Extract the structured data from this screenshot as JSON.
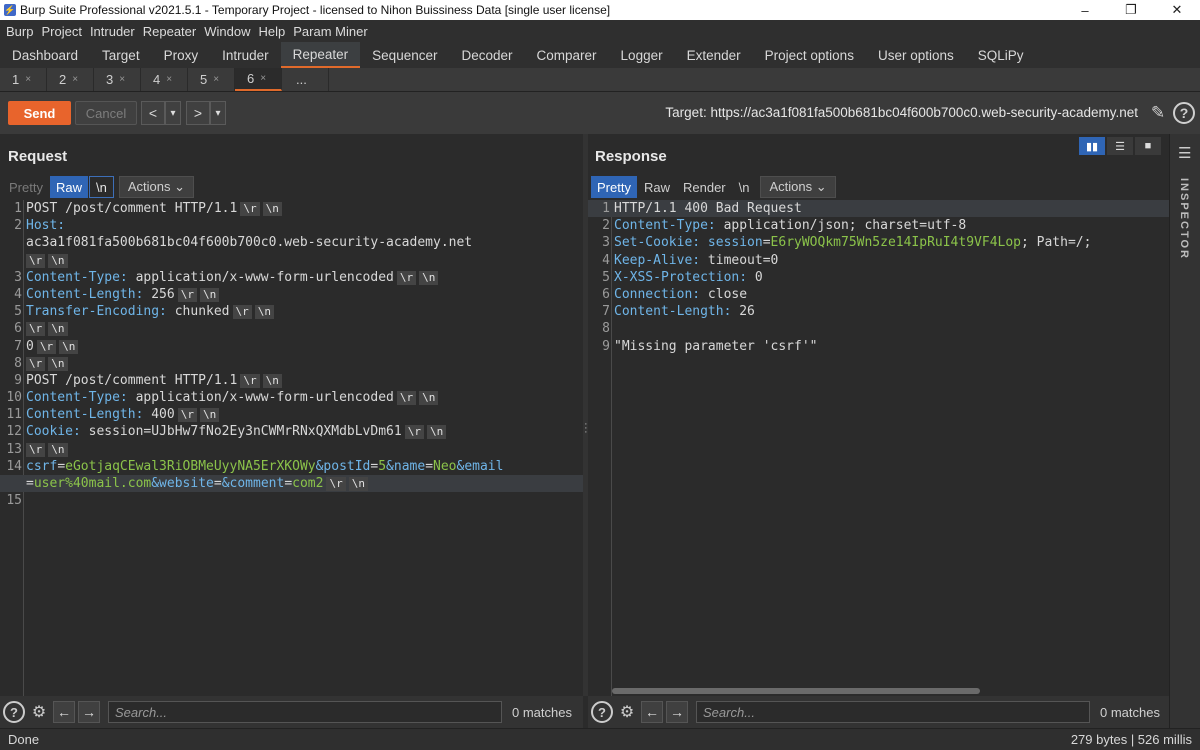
{
  "window": {
    "title": "Burp Suite Professional v2021.5.1 - Temporary Project - licensed to Nihon Buissiness Data [single user license]",
    "minimize": "–",
    "restore": "❐",
    "close": "✕"
  },
  "menu": [
    "Burp",
    "Project",
    "Intruder",
    "Repeater",
    "Window",
    "Help",
    "Param Miner"
  ],
  "main_tabs": [
    "Dashboard",
    "Target",
    "Proxy",
    "Intruder",
    "Repeater",
    "Sequencer",
    "Decoder",
    "Comparer",
    "Logger",
    "Extender",
    "Project options",
    "User options",
    "SQLiPy"
  ],
  "main_tab_active": "Repeater",
  "sub_tabs": [
    "1",
    "2",
    "3",
    "4",
    "5",
    "6"
  ],
  "sub_tab_active": "6",
  "sub_tab_close": "×",
  "sub_tab_more": "...",
  "toolbar": {
    "send_label": "Send",
    "cancel_label": "Cancel",
    "back": "<",
    "back_menu": "▾",
    "forward": ">",
    "forward_menu": "▾",
    "target_label": "Target: https://ac3a1f081fa500b681bc04f600b700c0.web-security-academy.net",
    "edit_icon": "✎",
    "help": "?"
  },
  "request": {
    "title": "Request",
    "tabs": {
      "pretty": "Pretty",
      "raw": "Raw",
      "newline": "\\n",
      "actions": "Actions ⌄"
    },
    "lines": {
      "l1": "POST /post/comment HTTP/1.1",
      "l2a": "Host:",
      "l2b": "ac3a1f081fa500b681bc04f600b700c0.web-security-academy.net",
      "l3n": "Content-Type:",
      "l3v": " application/x-www-form-urlencoded",
      "l4n": "Content-Length:",
      "l4v": " 256",
      "l5n": "Transfer-Encoding:",
      "l5v": " chunked",
      "l7": "0",
      "l9": "POST /post/comment HTTP/1.1",
      "l10n": "Content-Type:",
      "l10v": " application/x-www-form-urlencoded",
      "l11n": "Content-Length:",
      "l11v": " 400",
      "l12n": "Cookie:",
      "l12v": " session=UJbHw7fNo2Ey3nCWMrRNxQXMdbLvDm61",
      "l14a_n": "csrf",
      "l14a_v": "eGotjaqCEwal3RiOBMeUyyNA5ErXKOWy",
      "l14b_n": "&postId",
      "l14b_v": "5",
      "l14c_n": "&name",
      "l14c_v": "Neo",
      "l14d_n": "&email",
      "l14e_v": "user%40mail.com",
      "l14f_n": "&website",
      "l14f_eq": "=",
      "l14g_n": "&comment",
      "l14g_v": "com2"
    },
    "crlf_r": "\\r",
    "crlf_n": "\\n",
    "eq": "="
  },
  "response": {
    "title": "Response",
    "tabs": {
      "pretty": "Pretty",
      "raw": "Raw",
      "render": "Render",
      "newline": "\\n",
      "actions": "Actions ⌄"
    },
    "lines": {
      "l1": "HTTP/1.1 400 Bad Request",
      "l2n": "Content-Type:",
      "l2v": " application/json; charset=utf-8",
      "l3n": "Set-Cookie:",
      "l3a": " session",
      "l3v": "E6ryWOQkm75Wn5ze14IpRuI4t9VF4Lop",
      "l3c": "; Path=/;",
      "l4n": "Keep-Alive:",
      "l4v": " timeout=0",
      "l5n": "X-XSS-Protection:",
      "l5v": " 0",
      "l6n": "Connection:",
      "l6v": " close",
      "l7n": "Content-Length:",
      "l7v": " 26",
      "l9": "\"Missing parameter 'csrf'\""
    }
  },
  "line_numbers": [
    "1",
    "2",
    "3",
    "4",
    "5",
    "6",
    "7",
    "8",
    "9",
    "10",
    "11",
    "12",
    "13",
    "14",
    "15"
  ],
  "search": {
    "placeholder": "Search...",
    "matches": "0 matches",
    "help": "?",
    "gear": "⚙",
    "prev": "←",
    "next": "→"
  },
  "inspector": {
    "label": "INSPECTOR",
    "menu": "☰"
  },
  "status": {
    "left": "Done",
    "right": "279 bytes | 526 millis"
  },
  "colors": {
    "accent": "#e8642c",
    "selected_tab": "#2f65b5",
    "header_name": "#6fb5e8",
    "param_value": "#8bc34a"
  }
}
